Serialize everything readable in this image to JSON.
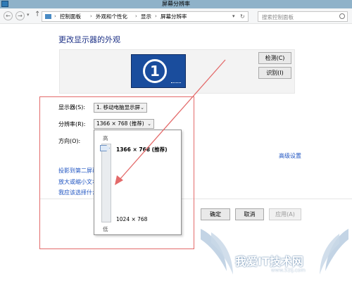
{
  "window": {
    "title": "屏幕分辨率",
    "app_icon": "display-settings-icon"
  },
  "navbar": {
    "back_glyph": "←",
    "forward_glyph": "→",
    "up_glyph": "↑",
    "breadcrumbs": [
      "控制面板",
      "外观和个性化",
      "显示",
      "屏幕分辨率"
    ],
    "breadcrumb_sep": "›",
    "refresh_glyph": "↻",
    "search_placeholder": "搜索控制面板"
  },
  "main": {
    "heading": "更改显示器的外观",
    "monitor_number": "1",
    "detect_label": "检测(C)",
    "identify_label": "识别(I)",
    "display_label": "显示器(S):",
    "display_value": "1. 移动电脑显示屏",
    "resolution_label": "分辨率(R):",
    "resolution_value": "1366 × 768 (推荐)",
    "orientation_label": "方向(O):",
    "advanced_link": "高级设置",
    "links": [
      "投影到第二屏幕",
      "放大或缩小文本",
      "我应该选择什么"
    ],
    "ok_label": "确定",
    "cancel_label": "取消",
    "apply_label": "应用(A)",
    "dropdown_glyph": "⌄"
  },
  "resolution_popup": {
    "high_label": "高",
    "low_label": "低",
    "max_resolution": "1366 × 768 (推荐)",
    "min_resolution": "1024 × 768",
    "slider_level": 1.0
  },
  "watermark": {
    "text": "我爱IT技术网",
    "url": "www.52ij.com"
  },
  "colors": {
    "titlebar": "#8fb2c9",
    "heading": "#1e3287",
    "link": "#1f54c2",
    "monitor": "#1a4d9d",
    "annotation": "#e36a6a"
  }
}
